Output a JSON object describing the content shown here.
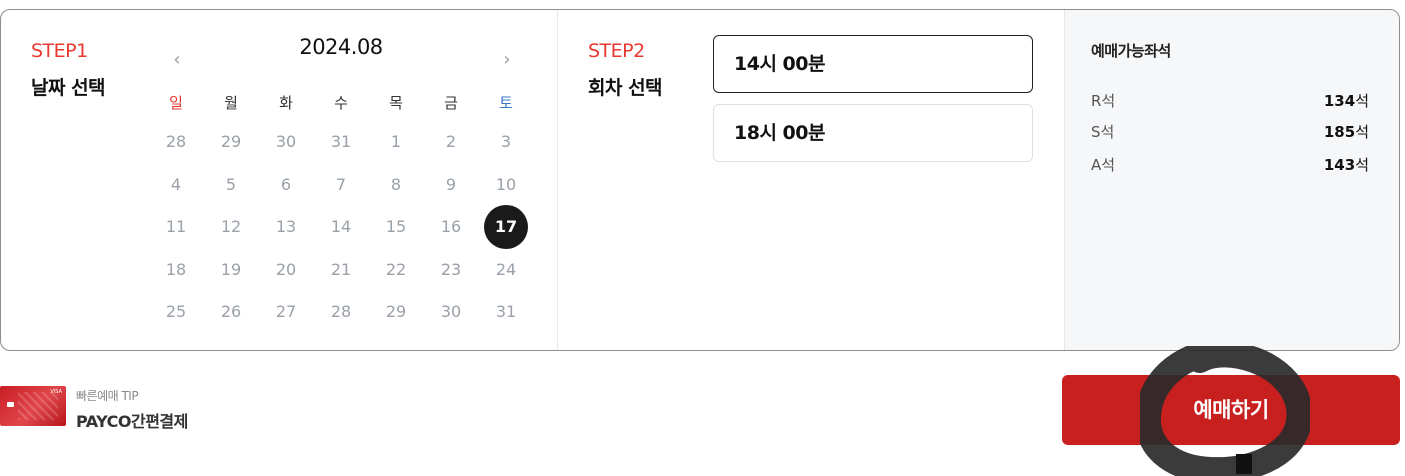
{
  "step1": {
    "label": "STEP1",
    "title": "날짜 선택",
    "prev_icon": "‹",
    "next_icon": "›",
    "month": "2024.08",
    "weekdays": [
      "일",
      "월",
      "화",
      "수",
      "목",
      "금",
      "토"
    ],
    "weeks": [
      [
        "28",
        "29",
        "30",
        "31",
        "1",
        "2",
        "3"
      ],
      [
        "4",
        "5",
        "6",
        "7",
        "8",
        "9",
        "10"
      ],
      [
        "11",
        "12",
        "13",
        "14",
        "15",
        "16",
        "17"
      ],
      [
        "18",
        "19",
        "20",
        "21",
        "22",
        "23",
        "24"
      ],
      [
        "25",
        "26",
        "27",
        "28",
        "29",
        "30",
        "31"
      ]
    ],
    "selected_day": "17"
  },
  "step2": {
    "label": "STEP2",
    "title": "회차 선택",
    "times": [
      "14시 00분",
      "18시 00분"
    ],
    "selected_time": "14시 00분"
  },
  "seats": {
    "title": "예매가능좌석",
    "unit": "석",
    "rows": [
      {
        "grade": "R석",
        "count": "134"
      },
      {
        "grade": "S석",
        "count": "185"
      },
      {
        "grade": "A석",
        "count": "143"
      }
    ]
  },
  "tip": {
    "label": "빠른예매 TIP",
    "link": "PAYCO간편결제",
    "card_brand": "VISA"
  },
  "book_button": "예매하기",
  "colors": {
    "accent": "#c8201f",
    "step_red": "#e8382f",
    "saturday_blue": "#3b78c9",
    "selected_day_bg": "#1a1a1a"
  }
}
